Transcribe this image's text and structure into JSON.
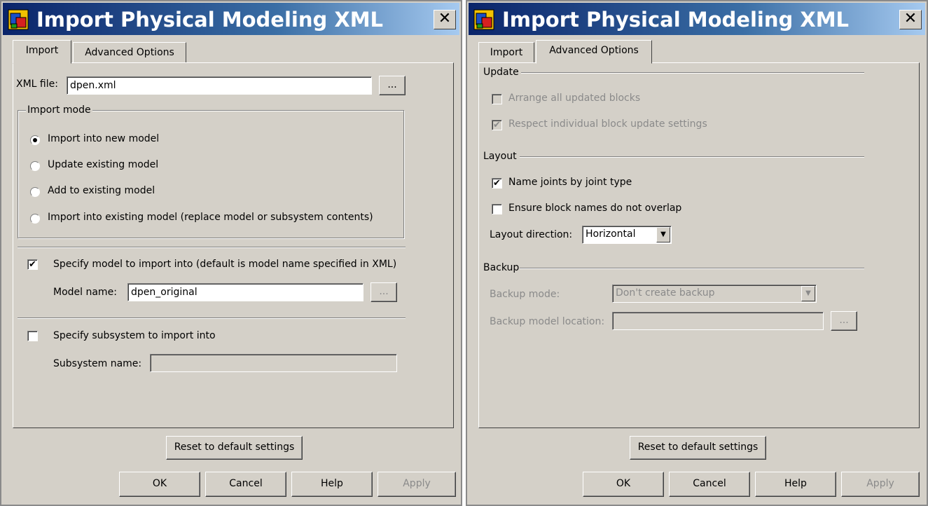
{
  "dialog": {
    "title": "Import Physical Modeling XML",
    "close_glyph": "✕",
    "icon": "simulink-block-icon"
  },
  "tabs": [
    "Import",
    "Advanced Options"
  ],
  "import_tab": {
    "xml_label": "XML file:",
    "xml_value": "dpen.xml",
    "browse_label": "...",
    "mode_group": "Import mode",
    "modes": [
      {
        "label": "Import into new model",
        "selected": true
      },
      {
        "label": "Update existing model",
        "selected": false
      },
      {
        "label": "Add to existing model",
        "selected": false
      },
      {
        "label": "Import into existing model (replace model or subsystem contents)",
        "selected": false
      }
    ],
    "specify_model_label": "Specify model to import into (default is model name specified in XML)",
    "specify_model_checked": true,
    "model_name_label": "Model name:",
    "model_name_value": "dpen_original",
    "specify_subsystem_label": "Specify subsystem to import into",
    "specify_subsystem_checked": false,
    "subsystem_name_label": "Subsystem name:",
    "subsystem_name_value": ""
  },
  "advanced_tab": {
    "update_group": "Update",
    "arrange_label": "Arrange all updated blocks",
    "arrange_checked": false,
    "respect_label": "Respect individual block update settings",
    "respect_checked": true,
    "layout_group": "Layout",
    "name_joints_label": "Name joints by joint type",
    "name_joints_checked": true,
    "ensure_names_label": "Ensure block names do not overlap",
    "ensure_names_checked": false,
    "layout_direction_label": "Layout direction:",
    "layout_direction_value": "Horizontal",
    "backup_group": "Backup",
    "backup_mode_label": "Backup mode:",
    "backup_mode_value": "Don't create backup",
    "backup_location_label": "Backup model location:",
    "backup_location_value": ""
  },
  "footer": {
    "reset": "Reset to default settings",
    "ok": "OK",
    "cancel": "Cancel",
    "help": "Help",
    "apply": "Apply"
  },
  "glyphs": {
    "check": "✔",
    "dropdown": "▼"
  }
}
